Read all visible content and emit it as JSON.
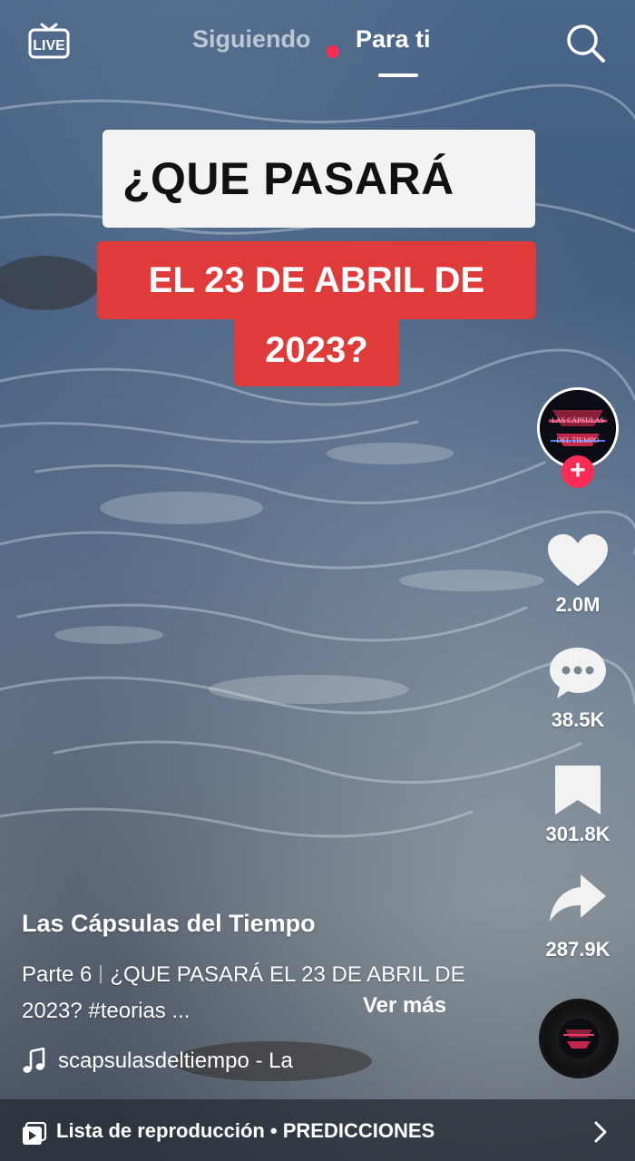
{
  "header": {
    "live_label": "LIVE",
    "tabs": [
      {
        "label": "Siguiendo",
        "active": false,
        "has_notification_dot": true
      },
      {
        "label": "Para ti",
        "active": true
      }
    ]
  },
  "video": {
    "caption_lines": [
      "¿QUE PASARÁ",
      "EL 23 DE ABRIL DE",
      "2023?"
    ],
    "caption_colors": {
      "line1_bg": "#f3f3f3",
      "line23_bg": "#e03b3b"
    }
  },
  "rail": {
    "avatar_text": "LAS CÁPSULAS DEL TIEMPO",
    "likes": "2.0M",
    "comments": "38.5K",
    "saves": "301.8K",
    "shares": "287.9K"
  },
  "post": {
    "author": "Las Cápsulas del Tiempo",
    "part": "Parte 6",
    "description": "¿QUE PASARÁ EL 23 DE ABRIL DE 2023? #teorias ...",
    "more": "Ver más",
    "music": "scapsulasdeltiempo - La"
  },
  "playlist": {
    "label": "Lista de reproducción • PREDICCIONES"
  },
  "colors": {
    "accent": "#fe2c55",
    "caption_red": "#e03b3b"
  },
  "icons": [
    "live-icon",
    "search-icon",
    "heart-icon",
    "comment-icon",
    "bookmark-icon",
    "share-icon",
    "music-note-icon",
    "playlist-icon",
    "chevron-right-icon"
  ]
}
